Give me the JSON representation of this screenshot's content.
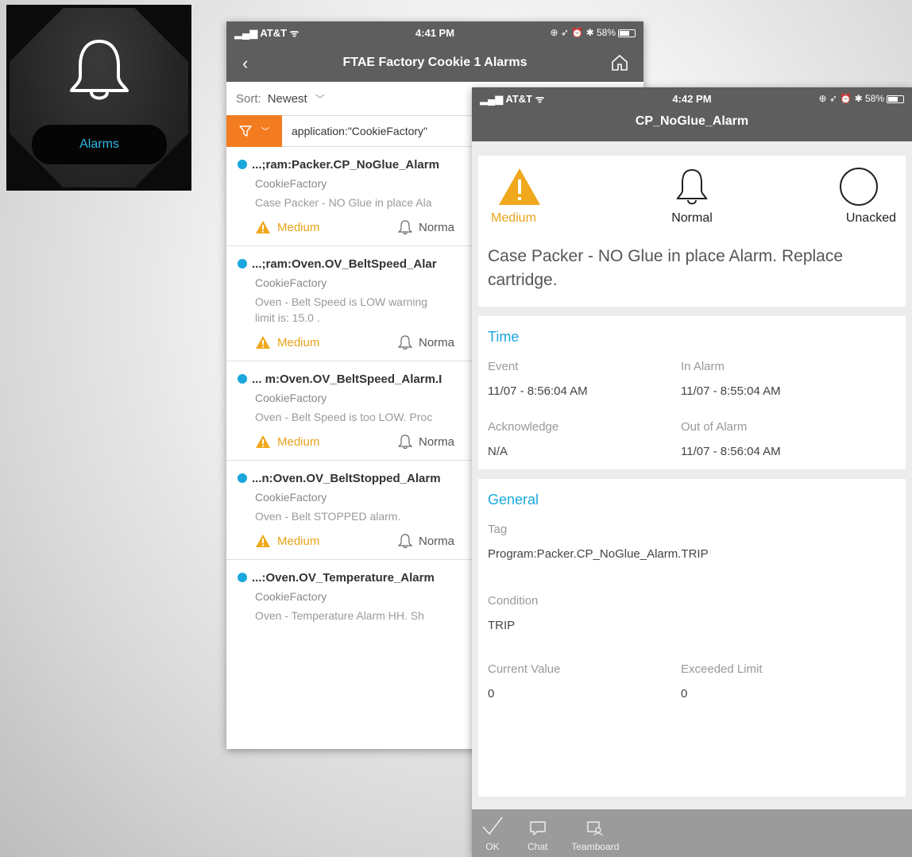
{
  "tile": {
    "label": "Alarms"
  },
  "list_phone": {
    "status": {
      "carrier": "AT&T",
      "time": "4:41 PM",
      "battery": "58%"
    },
    "title": "FTAE Factory Cookie 1 Alarms",
    "sort": {
      "label": "Sort:",
      "value": "Newest"
    },
    "filter": {
      "query": "application:\"CookieFactory\""
    },
    "alarms": [
      {
        "name": "...;ram:Packer.CP_NoGlue_Alarm",
        "app": "CookieFactory",
        "desc1": "Case Packer - NO Glue in place Ala",
        "desc2": "",
        "severity": "Medium",
        "state": "Norma"
      },
      {
        "name": "...;ram:Oven.OV_BeltSpeed_Alar",
        "app": "CookieFactory",
        "desc1": "Oven - Belt Speed is LOW warning",
        "desc2": "limit is: 15.0 .",
        "severity": "Medium",
        "state": "Norma"
      },
      {
        "name": "... m:Oven.OV_BeltSpeed_Alarm.I",
        "app": "CookieFactory",
        "desc1": "Oven - Belt Speed is too LOW. Proc",
        "desc2": "",
        "severity": "Medium",
        "state": "Norma"
      },
      {
        "name": "...n:Oven.OV_BeltStopped_Alarm",
        "app": "CookieFactory",
        "desc1": "Oven - Belt STOPPED alarm.",
        "desc2": "",
        "severity": "Medium",
        "state": "Norma"
      },
      {
        "name": "...:Oven.OV_Temperature_Alarm",
        "app": "CookieFactory",
        "desc1": "Oven - Temperature Alarm HH. Sh",
        "desc2": "",
        "severity": "",
        "state": ""
      }
    ]
  },
  "detail_phone": {
    "status": {
      "carrier": "AT&T",
      "time": "4:42 PM",
      "battery": "58%"
    },
    "title": "CP_NoGlue_Alarm",
    "severity": "Medium",
    "state": "Normal",
    "ack": "Unacked",
    "description": "Case Packer - NO Glue in place Alarm. Replace cartridge.",
    "time_section": {
      "heading": "Time",
      "event_label": "Event",
      "event_value": "11/07 - 8:56:04 AM",
      "in_alarm_label": "In Alarm",
      "in_alarm_value": "11/07 - 8:55:04 AM",
      "ack_label": "Acknowledge",
      "ack_value": "N/A",
      "out_label": "Out of Alarm",
      "out_value": "11/07 - 8:56:04 AM"
    },
    "general_section": {
      "heading": "General",
      "tag_label": "Tag",
      "tag_value": "Program:Packer.CP_NoGlue_Alarm.TRIP",
      "condition_label": "Condition",
      "condition_value": "TRIP",
      "current_label": "Current Value",
      "current_value": "0",
      "limit_label": "Exceeded Limit",
      "limit_value": "0"
    },
    "tabs": {
      "ok": "OK",
      "chat": "Chat",
      "teamboard": "Teamboard"
    }
  },
  "colors": {
    "accent": "#1aa7dd",
    "warning": "#e8a21a",
    "filter": "#f47c20",
    "header": "#5e5e5e"
  }
}
